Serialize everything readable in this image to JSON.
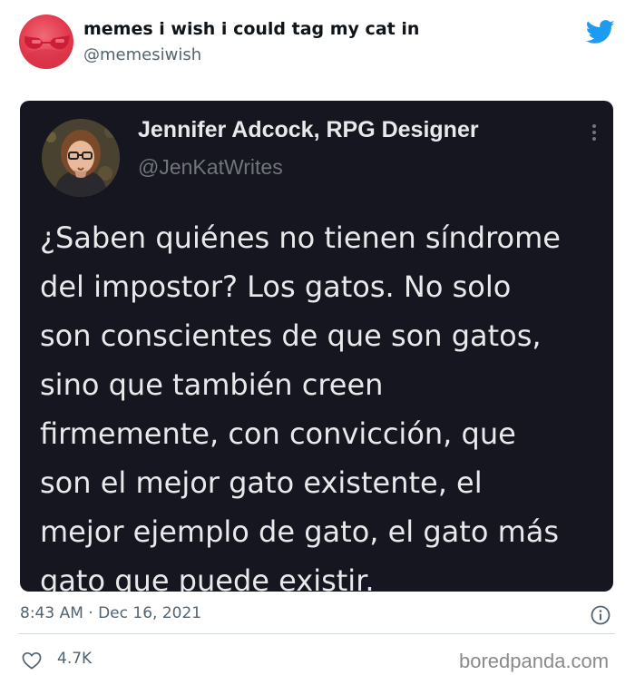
{
  "account": {
    "name": "memes i wish i could tag my cat in",
    "handle": "@memesiwish"
  },
  "quoted_tweet": {
    "author_name": "Jennifer Adcock, RPG Designer",
    "author_handle": "@JenKatWrites",
    "text": "¿Saben quiénes no tienen síndrome\ndel impostor? Los gatos. No solo\nson conscientes de que son gatos,\nsino que también creen\nfirmemente, con convicción, que\nson el mejor gato existente, el\nmejor ejemplo de gato, el gato más\ngato que puede existir."
  },
  "meta": {
    "timestamp": "8:43 AM · Dec 16, 2021",
    "likes": "4.7K"
  },
  "watermark": "boredpanda.com",
  "icons": {
    "brand": "twitter-bird-icon",
    "info": "info-icon",
    "like": "heart-icon",
    "more": "more-icon"
  },
  "colors": {
    "twitter_blue": "#1d9bf0",
    "card_bg": "#15161f",
    "secondary_text": "#536471"
  }
}
